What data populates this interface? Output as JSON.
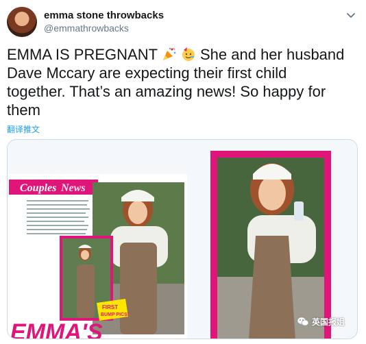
{
  "author": {
    "name": "emma stone throwbacks",
    "handle": "@emmathrowbacks"
  },
  "tweet": {
    "text_part1": "EMMA IS PREGNANT ",
    "text_part2": " She and her husband Dave Mccary are expecting their first child together. That’s an amazing news! So happy for them",
    "emojis": [
      "party-popper-icon",
      "partying-face-icon"
    ]
  },
  "translate_label": "翻译推文",
  "media": {
    "magazine_section": "CouplesNews",
    "magazine_section_word1": "Couples",
    "magazine_section_word2": "News",
    "badge_line1": "FIRST",
    "badge_line2": "BUMP PICS!",
    "magazine_big_text": "EMMA'S",
    "accent": "#e0157a"
  },
  "watermark": {
    "text": "英国报姐",
    "icon": "wechat-icon"
  }
}
